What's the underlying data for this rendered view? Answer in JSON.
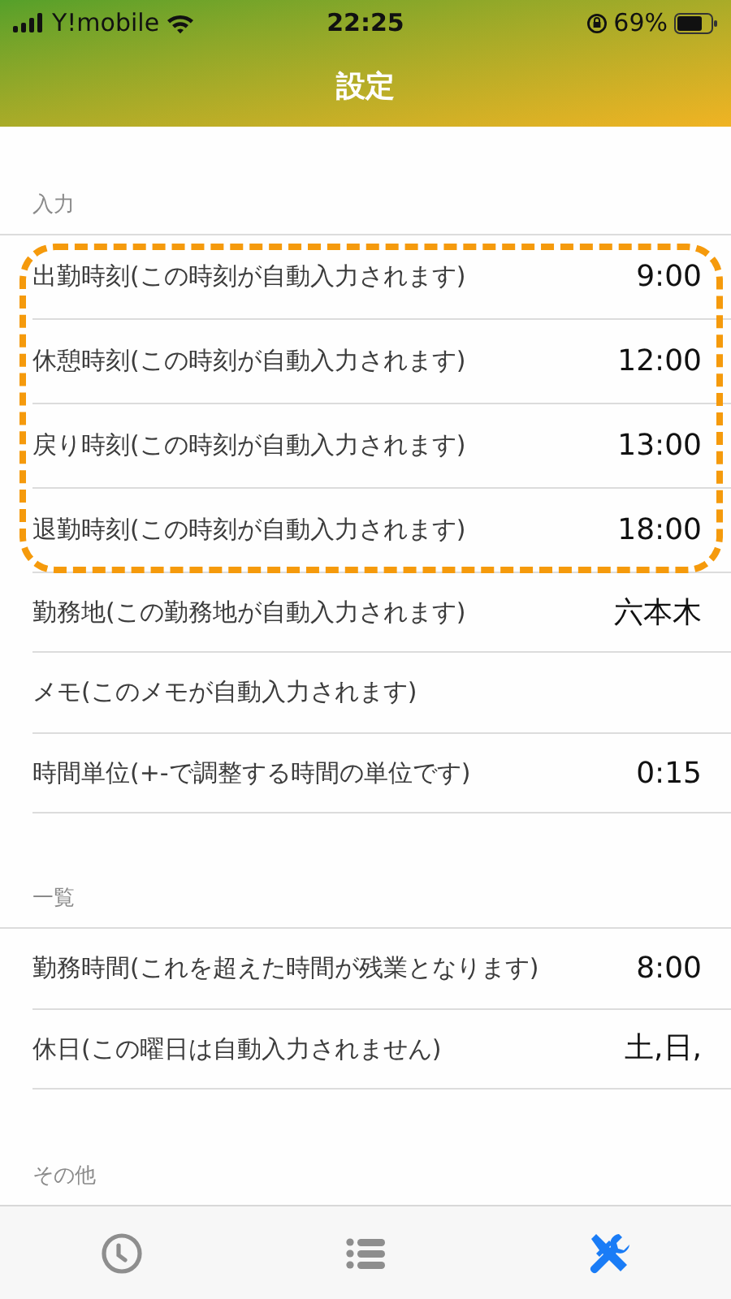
{
  "status_bar": {
    "carrier": "Y!mobile",
    "time": "22:25",
    "battery": "69%"
  },
  "nav": {
    "title": "設定"
  },
  "sections": [
    {
      "header": "入力",
      "rows": [
        {
          "label": "出勤時刻(この時刻が自動入力されます)",
          "value": "9:00",
          "highlighted": true
        },
        {
          "label": "休憩時刻(この時刻が自動入力されます)",
          "value": "12:00",
          "highlighted": true
        },
        {
          "label": "戻り時刻(この時刻が自動入力されます)",
          "value": "13:00",
          "highlighted": true
        },
        {
          "label": "退勤時刻(この時刻が自動入力されます)",
          "value": "18:00",
          "highlighted": true
        },
        {
          "label": "勤務地(この勤務地が自動入力されます)",
          "value": "六本木",
          "highlighted": false
        },
        {
          "label": "メモ(このメモが自動入力されます)",
          "highlighted": false
        },
        {
          "label": "時間単位(+-で調整する時間の単位です)",
          "value": "0:15",
          "highlighted": false
        }
      ]
    },
    {
      "header": "一覧",
      "rows": [
        {
          "label": "勤務時間(これを超えた時間が残業となります)",
          "value": "8:00",
          "highlighted": false
        },
        {
          "label": "休日(この曜日は自動入力されません)",
          "value": "土,日,",
          "highlighted": false
        }
      ]
    },
    {
      "header": "その他"
    }
  ],
  "tab_bar": [
    {
      "kind": "clock",
      "selected": false
    },
    {
      "kind": "list",
      "selected": false
    },
    {
      "kind": "tools",
      "selected": true
    }
  ]
}
